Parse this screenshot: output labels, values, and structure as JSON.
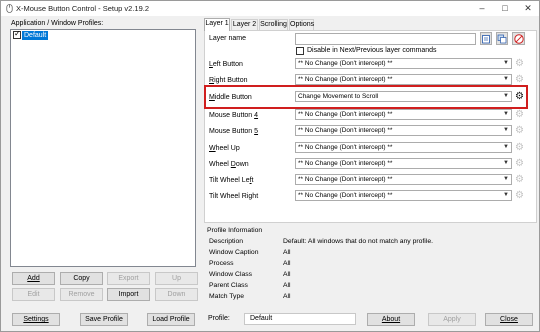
{
  "window": {
    "title": "X-Mouse Button Control - Setup v2.19.2"
  },
  "profiles": {
    "header": "Application / Window Profiles:",
    "items": [
      {
        "label": "Default",
        "checked": true,
        "selected": true
      }
    ],
    "buttons": {
      "add": "Add",
      "copy": "Copy",
      "export": "Export",
      "up": "Up",
      "edit": "Edit",
      "remove": "Remove",
      "import": "Import",
      "down": "Down"
    }
  },
  "tabs": [
    "Layer 1",
    "Layer 2",
    "Scrolling",
    "Options"
  ],
  "layer": {
    "name_label": "Layer name",
    "name_value": "",
    "disable_label": "Disable in Next/Previous layer commands",
    "rows": [
      {
        "label": "Left Button",
        "value": "** No Change (Don't intercept) **"
      },
      {
        "label": "Right Button",
        "value": "** No Change (Don't intercept) **"
      },
      {
        "label": "Middle Button",
        "value": "Change Movement to Scroll"
      },
      {
        "label": "Mouse Button 4",
        "value": "** No Change (Don't intercept) **"
      },
      {
        "label": "Mouse Button 5",
        "value": "** No Change (Don't intercept) **"
      },
      {
        "label": "Wheel Up",
        "value": "** No Change (Don't intercept) **"
      },
      {
        "label": "Wheel Down",
        "value": "** No Change (Don't intercept) **"
      },
      {
        "label": "Tilt Wheel Left",
        "value": "** No Change (Don't intercept) **"
      },
      {
        "label": "Tilt Wheel Right",
        "value": "** No Change (Don't intercept) **"
      }
    ]
  },
  "profile_info": {
    "title": "Profile Information",
    "rows": [
      {
        "label": "Description",
        "value": "Default: All windows that do not match any profile."
      },
      {
        "label": "Window Caption",
        "value": "All"
      },
      {
        "label": "Process",
        "value": "All"
      },
      {
        "label": "Window Class",
        "value": "All"
      },
      {
        "label": "Parent Class",
        "value": "All"
      },
      {
        "label": "Match Type",
        "value": "All"
      }
    ]
  },
  "bottom_bar": {
    "settings": "Settings",
    "save_profile": "Save Profile",
    "load_profile": "Load Profile",
    "profile_label": "Profile:",
    "profile_value": "Default",
    "about": "About",
    "apply": "Apply",
    "close": "Close"
  },
  "colors": {
    "highlight": "#d01e1e",
    "selection": "#0078d7"
  }
}
